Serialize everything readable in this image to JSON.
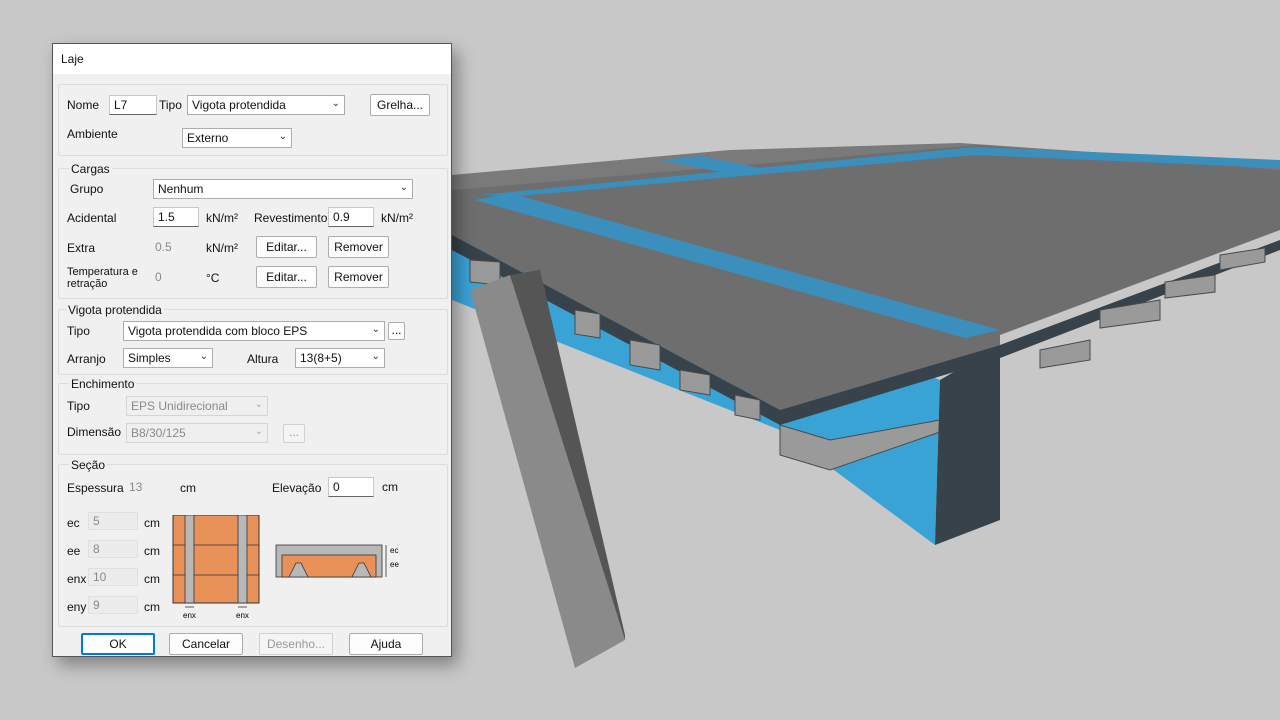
{
  "dialog": {
    "title": "Laje",
    "nome_label": "Nome",
    "nome_value": "L7",
    "tipo_label": "Tipo",
    "tipo_value": "Vigota protendida",
    "grelha_button": "Grelha...",
    "ambiente_label": "Ambiente",
    "ambiente_value": "Externo"
  },
  "cargas": {
    "title": "Cargas",
    "grupo_label": "Grupo",
    "grupo_value": "Nenhum",
    "acidental_label": "Acidental",
    "acidental_value": "1.5",
    "acidental_unit": "kN/m²",
    "revestimento_label": "Revestimento",
    "revestimento_value": "0.9",
    "revestimento_unit": "kN/m²",
    "extra_label": "Extra",
    "extra_value": "0.5",
    "extra_unit": "kN/m²",
    "editar_button": "Editar...",
    "remover_button": "Remover",
    "temperatura_label": "Temperatura e retração",
    "temperatura_value": "0",
    "temperatura_unit": "°C"
  },
  "vigota": {
    "title": "Vigota protendida",
    "tipo_label": "Tipo",
    "tipo_value": "Vigota protendida com bloco EPS",
    "more_button": "...",
    "arranjo_label": "Arranjo",
    "arranjo_value": "Simples",
    "altura_label": "Altura",
    "altura_value": "13(8+5)"
  },
  "enchimento": {
    "title": "Enchimento",
    "tipo_label": "Tipo",
    "tipo_value": "EPS Unidirecional",
    "dimensao_label": "Dimensão",
    "dimensao_value": "B8/30/125",
    "more_button": "..."
  },
  "secao": {
    "title": "Seção",
    "espessura_label": "Espessura",
    "espessura_value": "13",
    "espessura_unit": "cm",
    "elevacao_label": "Elevação",
    "elevacao_value": "0",
    "elevacao_unit": "cm",
    "ec_label": "ec",
    "ec_value": "5",
    "ee_label": "ee",
    "ee_value": "8",
    "enx_label": "enx",
    "enx_value": "10",
    "eny_label": "eny",
    "eny_value": "9",
    "unit": "cm",
    "diagram_enx_label": "enx",
    "diagram_ec_label": "ec",
    "diagram_ee_label": "ee"
  },
  "footer": {
    "ok": "OK",
    "cancelar": "Cancelar",
    "desenho": "Desenho...",
    "ajuda": "Ajuda"
  },
  "colors": {
    "slab": "#6e6e6e",
    "beam_dark": "#37424a",
    "blue_accent": "#3aa3d6",
    "eps": "#e8925a"
  }
}
